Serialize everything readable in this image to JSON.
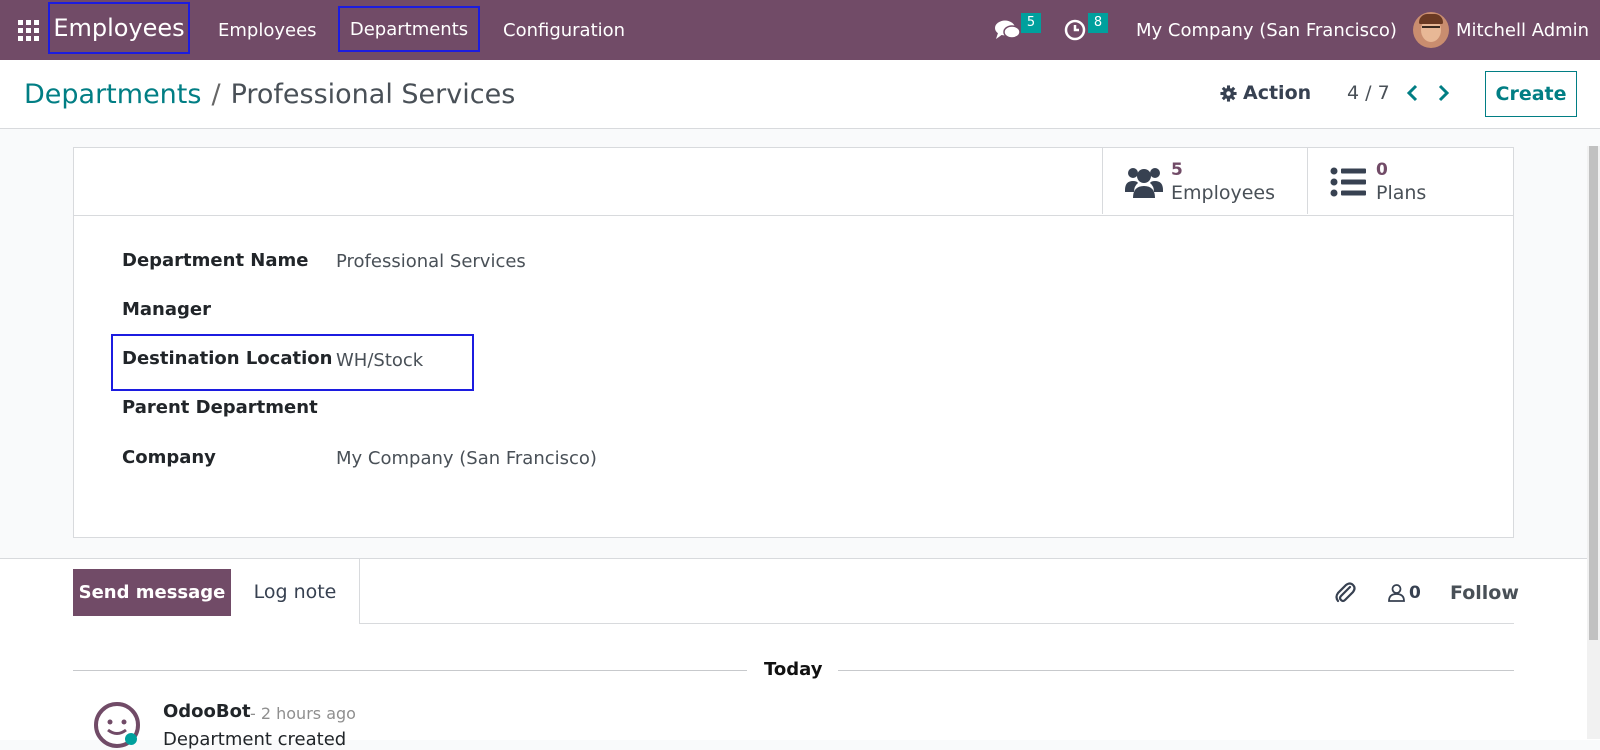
{
  "navbar": {
    "brand": "Employees",
    "menu": [
      "Employees",
      "Departments",
      "Configuration"
    ],
    "messages_count": "5",
    "activities_count": "8",
    "company": "My Company (San Francisco)",
    "user": "Mitchell Admin"
  },
  "control_panel": {
    "breadcrumb_parent": "Departments",
    "breadcrumb_separator": "/",
    "breadcrumb_current": "Professional Services",
    "action_label": "Action",
    "pager": "4 / 7",
    "create_label": "Create"
  },
  "stat_buttons": {
    "employees_value": "5",
    "employees_label": "Employees",
    "plans_value": "0",
    "plans_label": "Plans"
  },
  "form": {
    "fields": [
      {
        "label": "Department Name",
        "value": "Professional Services"
      },
      {
        "label": "Manager",
        "value": ""
      },
      {
        "label": "Destination Location",
        "value": "WH/Stock"
      },
      {
        "label": "Parent Department",
        "value": ""
      },
      {
        "label": "Company",
        "value": "My Company (San Francisco)"
      }
    ]
  },
  "chatter": {
    "send_message": "Send message",
    "log_note": "Log note",
    "followers_count": "0",
    "follow": "Follow",
    "date_separator": "Today",
    "message": {
      "author": "OdooBot",
      "time": "- 2 hours ago",
      "body": "Department created"
    }
  },
  "colors": {
    "navbar": "#714b67",
    "accent": "#017e84",
    "badge": "#00a09d",
    "highlight": "#1c1ce0"
  }
}
